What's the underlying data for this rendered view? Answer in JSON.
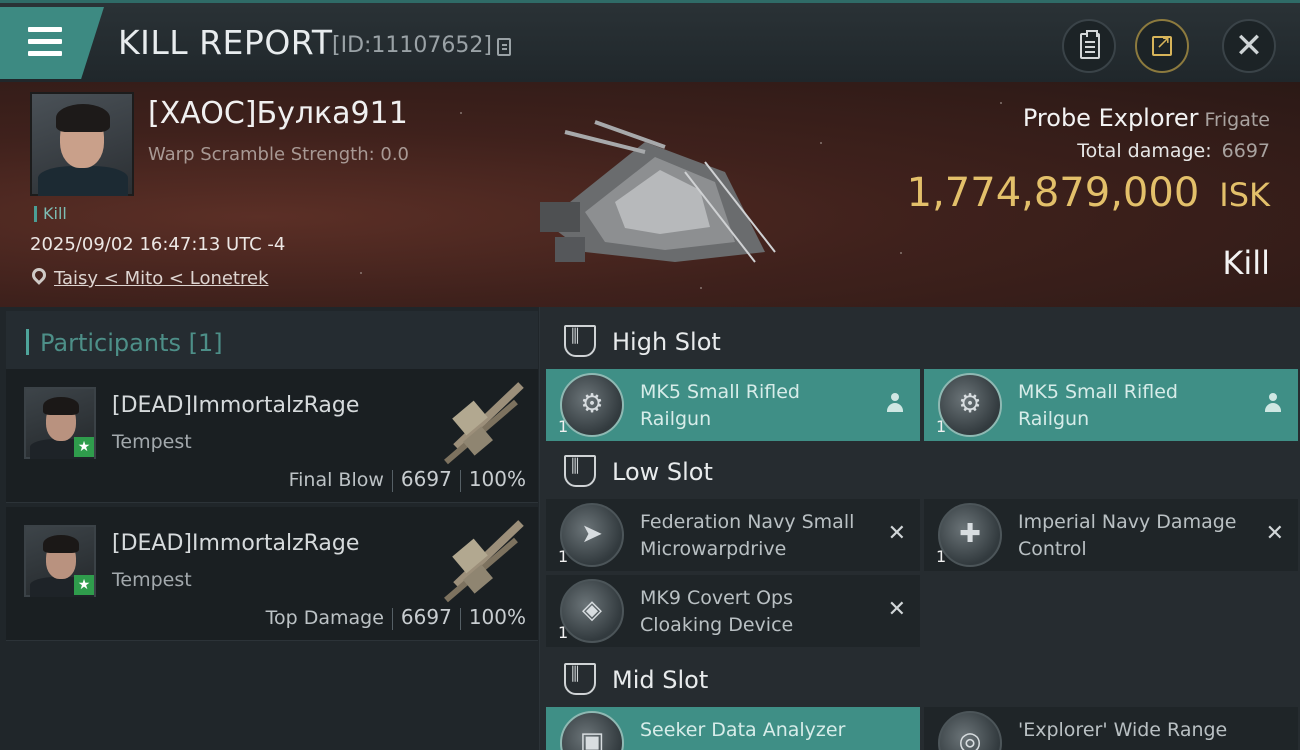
{
  "header": {
    "title": "KILL REPORT",
    "kill_id": "[ID:11107652]",
    "icons": [
      "menu-icon",
      "copy-icon",
      "clipboard-icon",
      "share-icon",
      "close-icon"
    ],
    "close_glyph": "✕"
  },
  "victim": {
    "name": "[XAOC]Булка911",
    "scramble": "Warp Scramble Strength: 0.0",
    "tag": "Kill",
    "datetime": "2025/09/02 16:47:13 UTC -4",
    "location": "Taisy < Mito < Lonetrek",
    "ship_name": "Probe Explorer",
    "ship_class": "Frigate",
    "total_damage_label": "Total damage:",
    "total_damage": "6697",
    "isk_value": "1,774,879,000",
    "isk_unit": "ISK",
    "result": "Kill",
    "colors": {
      "isk": "#e3c06a",
      "accent": "#3d8a82"
    }
  },
  "participants": {
    "header": "Participants [1]",
    "items": [
      {
        "name": "[DEAD]ImmortalzRage",
        "ship": "Tempest",
        "role": "Final Blow",
        "damage": "6697",
        "percent": "100%"
      },
      {
        "name": "[DEAD]ImmortalzRage",
        "ship": "Tempest",
        "role": "Top Damage",
        "damage": "6697",
        "percent": "100%"
      }
    ]
  },
  "fitting": {
    "high_label": "High Slot",
    "low_label": "Low Slot",
    "mid_label": "Mid Slot",
    "high": [
      {
        "qty": "1",
        "name": "MK5 Small Rifled Railgun",
        "status": "fitted",
        "icon": "railgun-icon"
      },
      {
        "qty": "1",
        "name": "MK5 Small Rifled Railgun",
        "status": "fitted",
        "icon": "railgun-icon"
      }
    ],
    "low": [
      {
        "qty": "1",
        "name": "Federation Navy Small Microwarpdrive",
        "status": "destroyed",
        "icon": "microwarpdrive-icon",
        "mark": "✕"
      },
      {
        "qty": "1",
        "name": "Imperial Navy Damage Control",
        "status": "destroyed",
        "icon": "damage-control-icon",
        "mark": "✕"
      },
      {
        "qty": "1",
        "name": "MK9 Covert Ops Cloaking Device",
        "status": "destroyed",
        "icon": "cloaking-device-icon",
        "mark": "✕"
      }
    ],
    "mid": [
      {
        "name": "Seeker Data Analyzer",
        "status": "fitted",
        "icon": "data-analyzer-icon"
      },
      {
        "name": "'Explorer' Wide Range",
        "status": "destroyed",
        "icon": "wide-range-icon"
      }
    ]
  }
}
